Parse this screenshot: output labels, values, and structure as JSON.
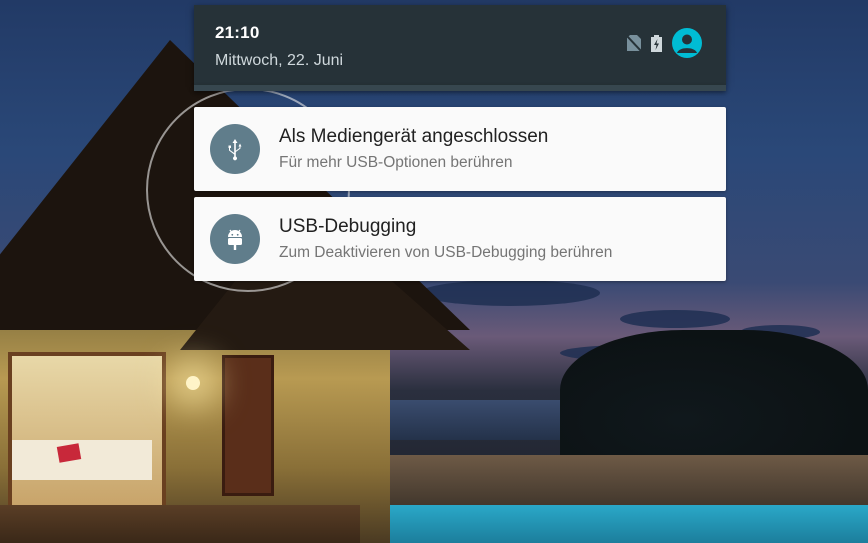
{
  "status": {
    "time": "21:10",
    "date": "Mittwoch, 22. Juni",
    "icons": [
      "no-sim-icon",
      "battery-charging-icon",
      "user-account-icon"
    ],
    "colors": {
      "header_bg": "#263238",
      "account_accent": "#00bcd4"
    }
  },
  "notifications": [
    {
      "icon": "usb-icon",
      "title": "Als Mediengerät angeschlossen",
      "text": "Für mehr USB-Optionen berühren"
    },
    {
      "icon": "android-icon",
      "title": "USB-Debugging",
      "text": "Zum Deaktivieren von USB-Debugging berühren"
    }
  ],
  "colors": {
    "icon_circle": "#607d8b",
    "card_bg": "#fafafa"
  }
}
